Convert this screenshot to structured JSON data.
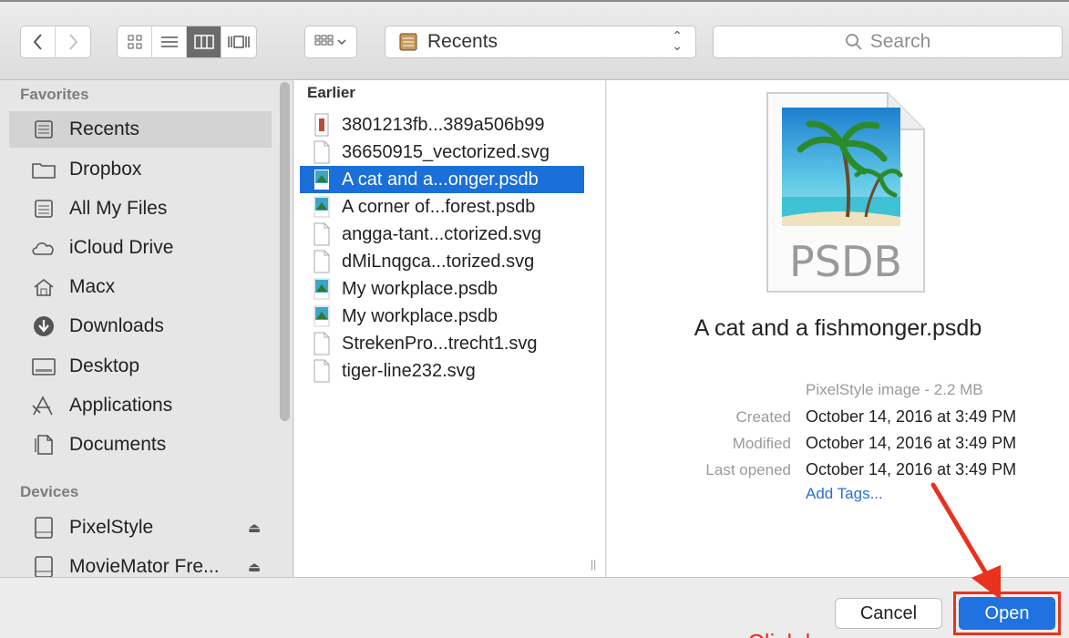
{
  "toolbar": {
    "location": "Recents",
    "search_placeholder": "Search"
  },
  "sidebar": {
    "favorites_header": "Favorites",
    "favorites": [
      {
        "label": "Recents",
        "icon": "recents-icon",
        "selected": true
      },
      {
        "label": "Dropbox",
        "icon": "folder-icon"
      },
      {
        "label": "All My Files",
        "icon": "all-files-icon"
      },
      {
        "label": "iCloud Drive",
        "icon": "cloud-icon"
      },
      {
        "label": "Macx",
        "icon": "home-icon"
      },
      {
        "label": "Downloads",
        "icon": "download-icon"
      },
      {
        "label": "Desktop",
        "icon": "desktop-icon"
      },
      {
        "label": "Applications",
        "icon": "applications-icon"
      },
      {
        "label": "Documents",
        "icon": "documents-icon"
      }
    ],
    "devices_header": "Devices",
    "devices": [
      {
        "label": "PixelStyle",
        "icon": "drive-icon"
      },
      {
        "label": "MovieMator Fre...",
        "icon": "drive-icon"
      }
    ]
  },
  "column": {
    "header": "Earlier",
    "files": [
      {
        "name": "3801213fb...389a506b99",
        "type": "image"
      },
      {
        "name": "36650915_vectorized.svg",
        "type": "doc"
      },
      {
        "name": "A cat and a...onger.psdb",
        "type": "psdb",
        "selected": true
      },
      {
        "name": "A corner of...forest.psdb",
        "type": "psdb"
      },
      {
        "name": "angga-tant...ctorized.svg",
        "type": "doc"
      },
      {
        "name": "dMiLnqgca...torized.svg",
        "type": "doc"
      },
      {
        "name": "My workplace.psdb",
        "type": "psdb"
      },
      {
        "name": "My workplace.psdb",
        "type": "psdb"
      },
      {
        "name": "StrekenPro...trecht1.svg",
        "type": "doc"
      },
      {
        "name": "tiger-line232.svg",
        "type": "doc"
      }
    ]
  },
  "preview": {
    "file_badge": "PSDB",
    "name": "A cat and a fishmonger.psdb",
    "kind": "PixelStyle image - 2.2 MB",
    "created_label": "Created",
    "created": "October 14, 2016 at 3:49 PM",
    "modified_label": "Modified",
    "modified": "October 14, 2016 at 3:49 PM",
    "opened_label": "Last opened",
    "opened": "October 14, 2016 at 3:49 PM",
    "add_tags": "Add Tags..."
  },
  "buttons": {
    "cancel": "Cancel",
    "open": "Open"
  },
  "annotation": {
    "text": "Click here",
    "color": "#e8321e"
  }
}
